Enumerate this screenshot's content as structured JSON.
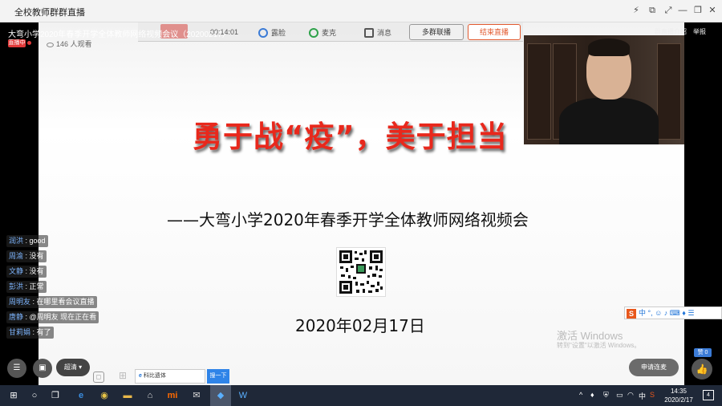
{
  "window": {
    "title": "全校教师群群直播",
    "controls": {
      "pin": "⚡",
      "pip": "⧉",
      "expand": "⤢",
      "minimize": "—",
      "restore": "❐",
      "close": "✕"
    }
  },
  "stream": {
    "title": "大弯小学2020年春季开学全体教师网络视频会议（20200217）",
    "live_badge": "直播中",
    "viewers": "146 人观看"
  },
  "toolbar": {
    "timer": "00:14:01",
    "camera_label": "露脸",
    "mic_label": "麦克",
    "messages_label": "消息",
    "multi_group_label": "多群联播",
    "end_live_label": "结束直播"
  },
  "header_links": {
    "intro": "群直播介绍",
    "report": "举报"
  },
  "slide": {
    "slogan": "勇于战“疫”，美于担当",
    "meeting_title": "——大弯小学2020年春季开学全体教师网络视频会",
    "date": "2020年02月17日"
  },
  "chat": [
    {
      "user": "润洪",
      "text": "good"
    },
    {
      "user": "周渝",
      "text": "没有"
    },
    {
      "user": "文静",
      "text": "没有"
    },
    {
      "user": "彭洪",
      "text": "正常"
    },
    {
      "user": "周明友",
      "text": "在哪里看会议直播"
    },
    {
      "user": "唐静",
      "text": "@周明友 现在正在看"
    },
    {
      "user": "甘莉娟",
      "text": "有了"
    }
  ],
  "controls": {
    "quality_label": "超清 ▾",
    "search_text": "科比遗体",
    "search_button": "搜一下",
    "apply_mic_label": "申请连麦",
    "like_count": "赞 0",
    "like_icon": "👍"
  },
  "watermark": {
    "line1": "激活 Windows",
    "line2": "转到\"设置\"以激活 Windows。"
  },
  "ime": {
    "logo": "S",
    "items": "中 °, ☺ ♪ ⌨ ♦ ☰"
  },
  "taskbar": {
    "clock_time": "14:35",
    "clock_date": "2020/2/17",
    "tray_lang": "中",
    "notification_count": "4"
  },
  "colors": {
    "slogan_red": "#e8281c",
    "accent_blue": "#3b7bd6",
    "end_live_orange": "#e25a2f",
    "taskbar_bg": "#1f2838"
  }
}
